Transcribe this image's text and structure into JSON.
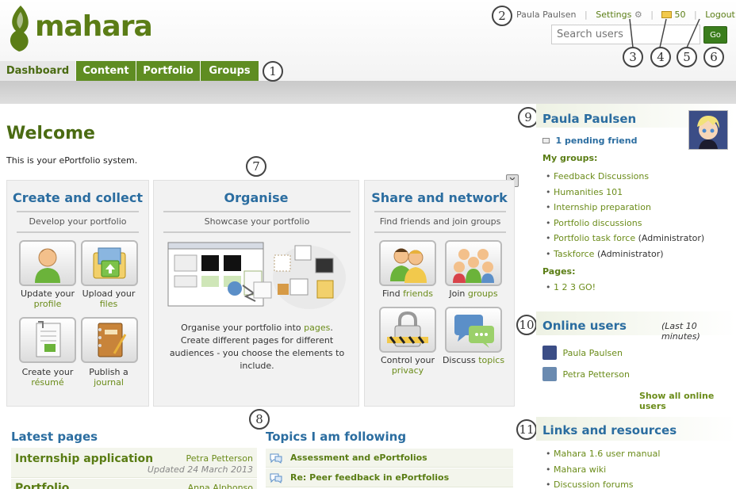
{
  "app": {
    "logo_text": "mahara"
  },
  "header": {
    "user_name": "Paula Paulsen",
    "settings_label": "Settings",
    "inbox_count": "50",
    "logout_label": "Logout",
    "search_placeholder": "Search users",
    "go_label": "Go"
  },
  "nav": {
    "tabs": [
      "Dashboard",
      "Content",
      "Portfolio",
      "Groups"
    ],
    "active": "Dashboard"
  },
  "callouts": [
    "1",
    "2",
    "3",
    "4",
    "5",
    "6",
    "7",
    "8",
    "9",
    "10",
    "11"
  ],
  "main": {
    "welcome_title": "Welcome",
    "welcome_text": "This is your ePortfolio system.",
    "close_symbol": "✕",
    "panels": [
      {
        "title": "Create and collect",
        "subtitle": "Develop your portfolio",
        "tiles": [
          {
            "line1": "Update your",
            "link": "profile",
            "icon": "user-profile-icon"
          },
          {
            "line1": "Upload your",
            "link": "files",
            "icon": "upload-files-icon"
          },
          {
            "line1": "Create your",
            "link": "résumé",
            "icon": "resume-icon"
          },
          {
            "line1": "Publish a",
            "link": "journal",
            "icon": "journal-icon"
          }
        ]
      },
      {
        "title": "Organise",
        "subtitle": "Showcase your portfolio",
        "text_before": "Organise your portfolio into ",
        "text_link": "pages",
        "text_after": ". Create different pages for different audiences - you choose the elements to include."
      },
      {
        "title": "Share and network",
        "subtitle": "Find friends and join groups",
        "tiles": [
          {
            "line1": "Find",
            "link": "friends",
            "icon": "friends-icon"
          },
          {
            "line1": "Join",
            "link": "groups",
            "icon": "groups-icon"
          },
          {
            "line1": "Control your",
            "link": "privacy",
            "icon": "privacy-icon"
          },
          {
            "line1": "Discuss",
            "link": "topics",
            "icon": "topics-icon"
          }
        ]
      }
    ]
  },
  "latest_pages": {
    "title": "Latest pages",
    "items": [
      {
        "name": "Internship application",
        "owner": "Petra Petterson",
        "updated": "Updated 24 March 2013"
      },
      {
        "name": "Portfolio",
        "owner": "Anna Alphonso"
      }
    ]
  },
  "topics": {
    "title": "Topics I am following",
    "items": [
      "Assessment and ePortfolios",
      "Re: Peer feedback in ePortfolios"
    ]
  },
  "profile": {
    "name": "Paula Paulsen",
    "pending": "1 pending friend",
    "groups_label": "My groups:",
    "groups": [
      {
        "name": "Feedback Discussions",
        "role": ""
      },
      {
        "name": "Humanities 101",
        "role": ""
      },
      {
        "name": "Internship preparation",
        "role": ""
      },
      {
        "name": "Portfolio discussions",
        "role": ""
      },
      {
        "name": "Portfolio task force",
        "role": " (Administrator)"
      },
      {
        "name": "Taskforce",
        "role": " (Administrator)"
      }
    ],
    "pages_label": "Pages:",
    "pages": [
      "1 2 3 GO!"
    ]
  },
  "online_users": {
    "title": "Online users",
    "note": "(Last 10 minutes)",
    "users": [
      "Paula Paulsen",
      "Petra Petterson"
    ],
    "show_all": "Show all online users"
  },
  "links": {
    "title": "Links and resources",
    "items": [
      "Mahara 1.6 user manual",
      "Mahara wiki",
      "Discussion forums"
    ]
  },
  "colors": {
    "brand_green": "#5f8d22",
    "heading_blue": "#2b6da0",
    "link_green": "#6b8c1a"
  }
}
